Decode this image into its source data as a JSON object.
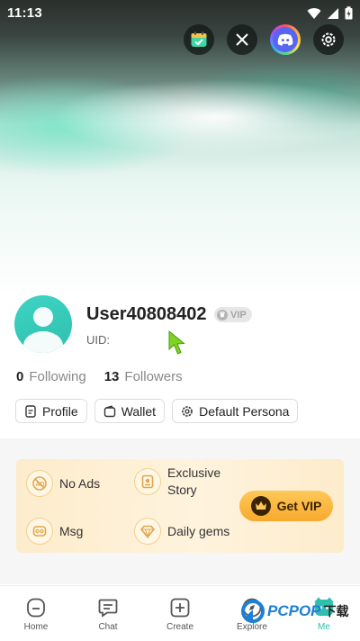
{
  "status_bar": {
    "time": "11:13"
  },
  "top_icons": [
    "calendar-check-icon",
    "x-icon",
    "discord-icon",
    "settings-icon"
  ],
  "profile": {
    "username": "User40808402",
    "vip_badge": "VIP",
    "uid_label": "UID:",
    "following_count": "0",
    "following_label": "Following",
    "followers_count": "13",
    "followers_label": "Followers"
  },
  "actions": {
    "profile": "Profile",
    "wallet": "Wallet",
    "persona": "Default Persona"
  },
  "vip_card": {
    "benefits": [
      {
        "label": "No Ads",
        "icon": "no-ads-icon"
      },
      {
        "label": "Exclusive\nStory",
        "icon": "story-icon"
      },
      {
        "label": "Msg",
        "icon": "message-icon"
      },
      {
        "label": "Daily gems",
        "icon": "gem-icon"
      }
    ],
    "button": "Get VIP",
    "colors": {
      "card": "#fdeccc",
      "button": "#f7a92f"
    }
  },
  "bottom_nav": {
    "items": [
      {
        "label": "Home",
        "icon": "home-icon"
      },
      {
        "label": "Chat",
        "icon": "chat-icon"
      },
      {
        "label": "Create",
        "icon": "create-icon"
      },
      {
        "label": "Explore",
        "icon": "explore-icon"
      },
      {
        "label": "Me",
        "icon": "me-icon"
      }
    ],
    "active": "Me",
    "accent": "#2fbfae"
  },
  "watermark": {
    "brand": "PCPOP",
    "cn": "下载"
  }
}
